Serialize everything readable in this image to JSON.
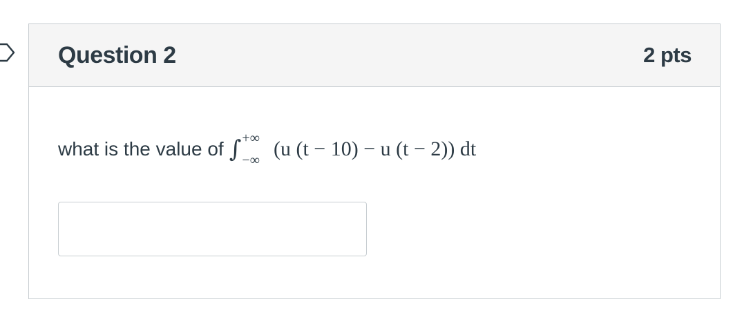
{
  "question": {
    "title": "Question 2",
    "points": "2 pts",
    "prompt": "what is the value of",
    "math": {
      "integral_sign": "∫",
      "upper_limit": "+∞",
      "lower_limit": "−∞",
      "integrand": "(u (t − 10) − u (t − 2)) dt"
    },
    "answer": {
      "value": "",
      "placeholder": ""
    }
  }
}
